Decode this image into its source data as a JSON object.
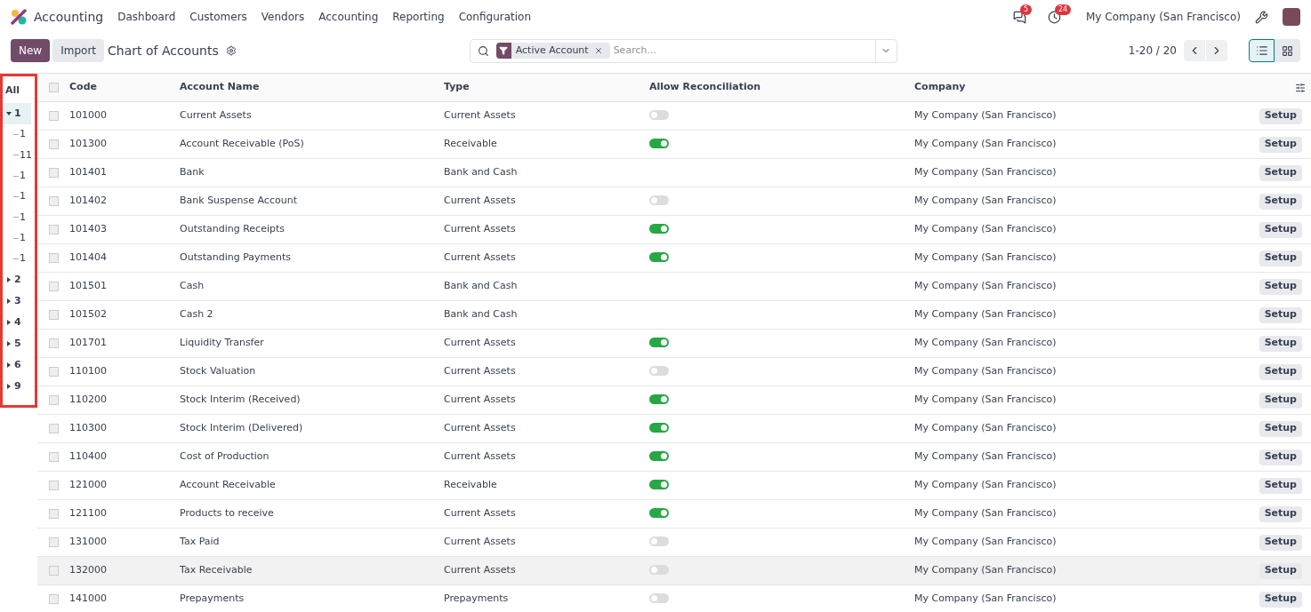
{
  "nav": {
    "app": "Accounting",
    "menu": [
      "Dashboard",
      "Customers",
      "Vendors",
      "Accounting",
      "Reporting",
      "Configuration"
    ],
    "messages_badge": "5",
    "activities_badge": "24",
    "company": "My Company (San Francisco)"
  },
  "control": {
    "new": "New",
    "import": "Import",
    "title": "Chart of Accounts",
    "facet": "Active Account",
    "placeholder": "Search...",
    "pager": "1-20 / 20",
    "views": [
      {
        "kind": "list",
        "selected": true
      },
      {
        "kind": "kanban",
        "selected": false
      }
    ]
  },
  "tree": {
    "all": "All",
    "items": [
      {
        "label": "1",
        "expanded": true,
        "selected": true,
        "children": [
          {
            "label": "1"
          },
          {
            "label": "11"
          },
          {
            "label": "1"
          },
          {
            "label": "1"
          },
          {
            "label": "1"
          },
          {
            "label": "1"
          },
          {
            "label": "1"
          }
        ]
      },
      {
        "label": "2",
        "expanded": false,
        "selected": false
      },
      {
        "label": "3",
        "expanded": false,
        "selected": false
      },
      {
        "label": "4",
        "expanded": false,
        "selected": false
      },
      {
        "label": "5",
        "expanded": false,
        "selected": false
      },
      {
        "label": "6",
        "expanded": false,
        "selected": false
      },
      {
        "label": "9",
        "expanded": false,
        "selected": false
      }
    ]
  },
  "table": {
    "all_checked": false,
    "columns": [
      "Code",
      "Account Name",
      "Type",
      "Allow Reconciliation",
      "Company"
    ],
    "rows": [
      {
        "checked": false,
        "code": "101000",
        "name": "Current Assets",
        "type": "Current Assets",
        "reconcile": false,
        "company": "My Company (San Francisco)",
        "action": "Setup",
        "hovered": false
      },
      {
        "checked": false,
        "code": "101300",
        "name": "Account Receivable (PoS)",
        "type": "Receivable",
        "reconcile": true,
        "company": "My Company (San Francisco)",
        "action": "Setup",
        "hovered": false
      },
      {
        "checked": false,
        "code": "101401",
        "name": "Bank",
        "type": "Bank and Cash",
        "company": "My Company (San Francisco)",
        "action": "Setup",
        "hovered": false
      },
      {
        "checked": false,
        "code": "101402",
        "name": "Bank Suspense Account",
        "type": "Current Assets",
        "reconcile": false,
        "company": "My Company (San Francisco)",
        "action": "Setup",
        "hovered": false
      },
      {
        "checked": false,
        "code": "101403",
        "name": "Outstanding Receipts",
        "type": "Current Assets",
        "reconcile": true,
        "company": "My Company (San Francisco)",
        "action": "Setup",
        "hovered": false
      },
      {
        "checked": false,
        "code": "101404",
        "name": "Outstanding Payments",
        "type": "Current Assets",
        "reconcile": true,
        "company": "My Company (San Francisco)",
        "action": "Setup",
        "hovered": false
      },
      {
        "checked": false,
        "code": "101501",
        "name": "Cash",
        "type": "Bank and Cash",
        "company": "My Company (San Francisco)",
        "action": "Setup",
        "hovered": false
      },
      {
        "checked": false,
        "code": "101502",
        "name": "Cash 2",
        "type": "Bank and Cash",
        "company": "My Company (San Francisco)",
        "action": "Setup",
        "hovered": false
      },
      {
        "checked": false,
        "code": "101701",
        "name": "Liquidity Transfer",
        "type": "Current Assets",
        "reconcile": true,
        "company": "My Company (San Francisco)",
        "action": "Setup",
        "hovered": false
      },
      {
        "checked": false,
        "code": "110100",
        "name": "Stock Valuation",
        "type": "Current Assets",
        "reconcile": false,
        "company": "My Company (San Francisco)",
        "action": "Setup",
        "hovered": false
      },
      {
        "checked": false,
        "code": "110200",
        "name": "Stock Interim (Received)",
        "type": "Current Assets",
        "reconcile": true,
        "company": "My Company (San Francisco)",
        "action": "Setup",
        "hovered": false
      },
      {
        "checked": false,
        "code": "110300",
        "name": "Stock Interim (Delivered)",
        "type": "Current Assets",
        "reconcile": true,
        "company": "My Company (San Francisco)",
        "action": "Setup",
        "hovered": false
      },
      {
        "checked": false,
        "code": "110400",
        "name": "Cost of Production",
        "type": "Current Assets",
        "reconcile": true,
        "company": "My Company (San Francisco)",
        "action": "Setup",
        "hovered": false
      },
      {
        "checked": false,
        "code": "121000",
        "name": "Account Receivable",
        "type": "Receivable",
        "reconcile": true,
        "company": "My Company (San Francisco)",
        "action": "Setup",
        "hovered": false
      },
      {
        "checked": false,
        "code": "121100",
        "name": "Products to receive",
        "type": "Current Assets",
        "reconcile": true,
        "company": "My Company (San Francisco)",
        "action": "Setup",
        "hovered": false
      },
      {
        "checked": false,
        "code": "131000",
        "name": "Tax Paid",
        "type": "Current Assets",
        "reconcile": false,
        "company": "My Company (San Francisco)",
        "action": "Setup",
        "hovered": false
      },
      {
        "checked": false,
        "code": "132000",
        "name": "Tax Receivable",
        "type": "Current Assets",
        "reconcile": false,
        "company": "My Company (San Francisco)",
        "action": "Setup",
        "hovered": true
      },
      {
        "checked": false,
        "code": "141000",
        "name": "Prepayments",
        "type": "Prepayments",
        "reconcile": false,
        "company": "My Company (San Francisco)",
        "action": "Setup",
        "hovered": false
      }
    ]
  }
}
